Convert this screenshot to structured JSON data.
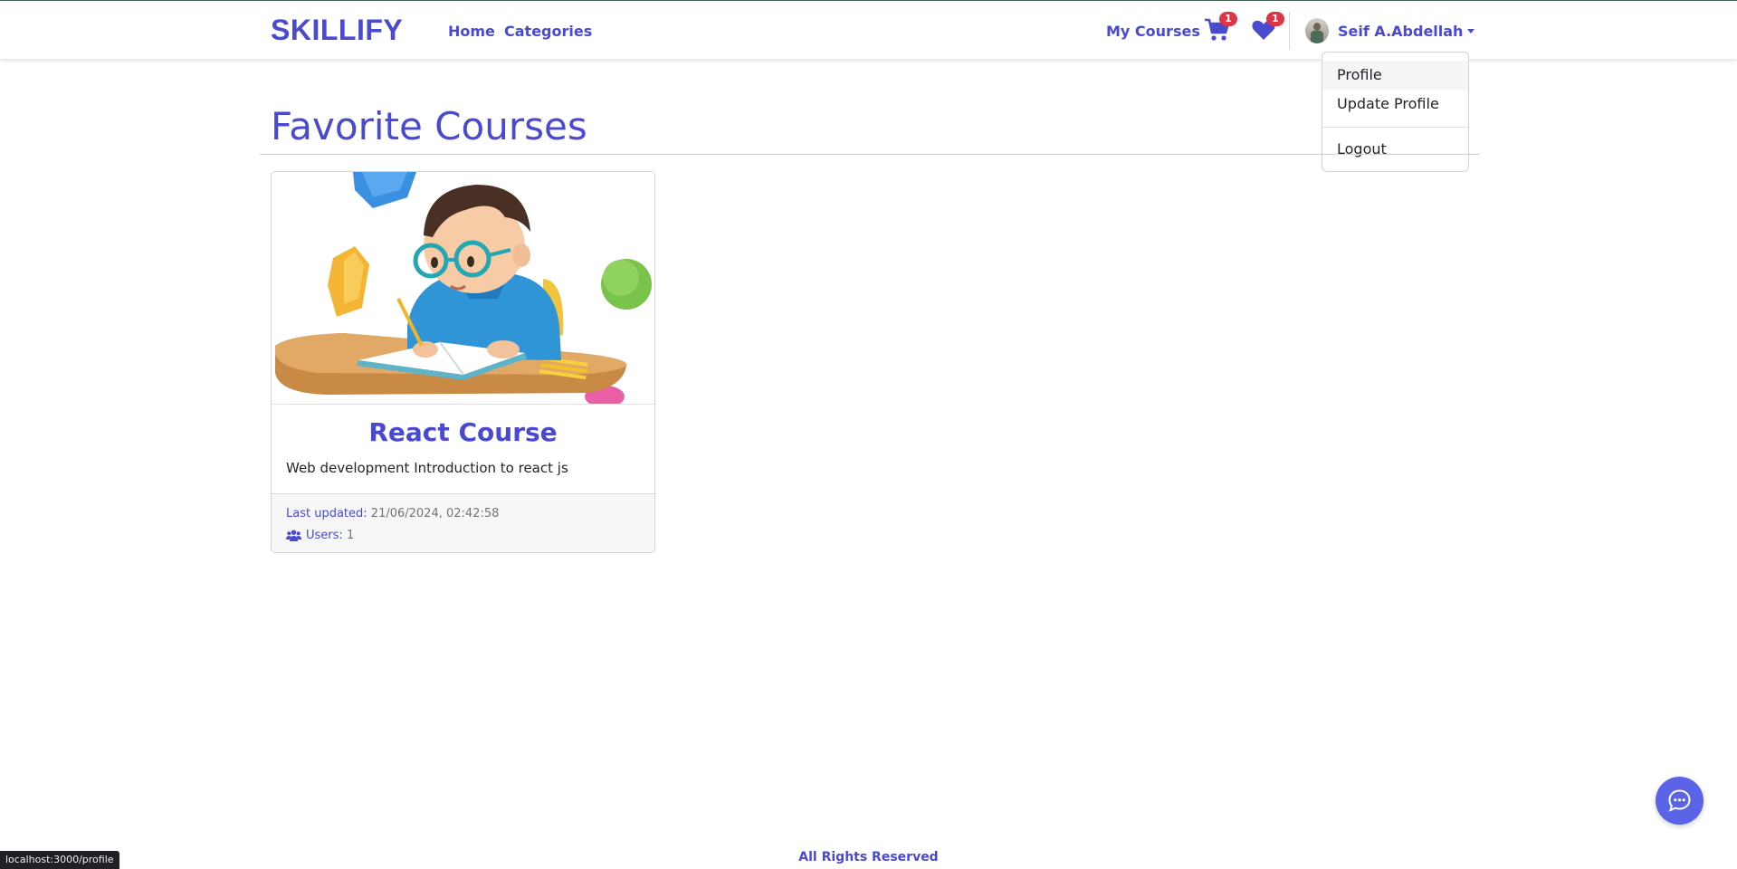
{
  "navbar": {
    "brand": "SKILLIFY",
    "links": {
      "home": "Home",
      "categories": "Categories",
      "my_courses": "My Courses"
    },
    "cart_icon": "cart-icon",
    "cart_count": "1",
    "favorites_icon": "heart-icon",
    "favorites_count": "1",
    "user_name": "Seif A.Abdellah"
  },
  "dropdown": {
    "profile": "Profile",
    "update_profile": "Update Profile",
    "logout": "Logout"
  },
  "page": {
    "title": "Favorite Courses"
  },
  "course_card": {
    "title": "React Course",
    "description": "Web development Introduction to react js",
    "last_updated_label": "Last updated:",
    "last_updated_value": "21/06/2024, 02:42:58",
    "users_icon": "users-icon",
    "users_label": "Users:",
    "users_value": "1"
  },
  "footer": {
    "text": "All Rights Reserved"
  },
  "status_bar": {
    "url": "localhost:3000/profile"
  },
  "chat_icon": "chat-bubble-icon",
  "colors": {
    "accent": "#4a4ad0",
    "badge": "#dc3545",
    "chat_button": "#5b63e6"
  }
}
